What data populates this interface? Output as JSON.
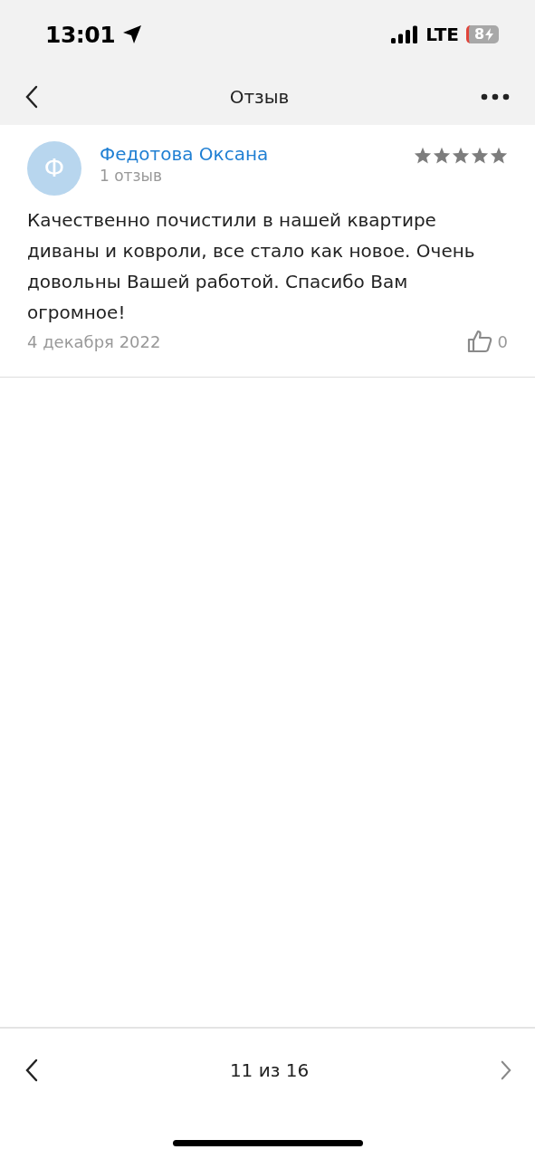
{
  "status_bar": {
    "time": "13:01",
    "network": "LTE",
    "battery": "8"
  },
  "nav_bar": {
    "title": "Отзыв"
  },
  "review": {
    "avatar_letter": "Ф",
    "author": "Федотова Оксана",
    "author_reviews": "1 отзыв",
    "stars": 5,
    "text": "Качественно почистили в нашей квартире диваны и ковроли, все стало как новое. Очень довольны Вашей работой. Спасибо Вам огромное!",
    "date": "4 декабря 2022",
    "likes": "0"
  },
  "pager": {
    "label": "11 из 16",
    "previous_disabled": false,
    "next_disabled": true
  }
}
